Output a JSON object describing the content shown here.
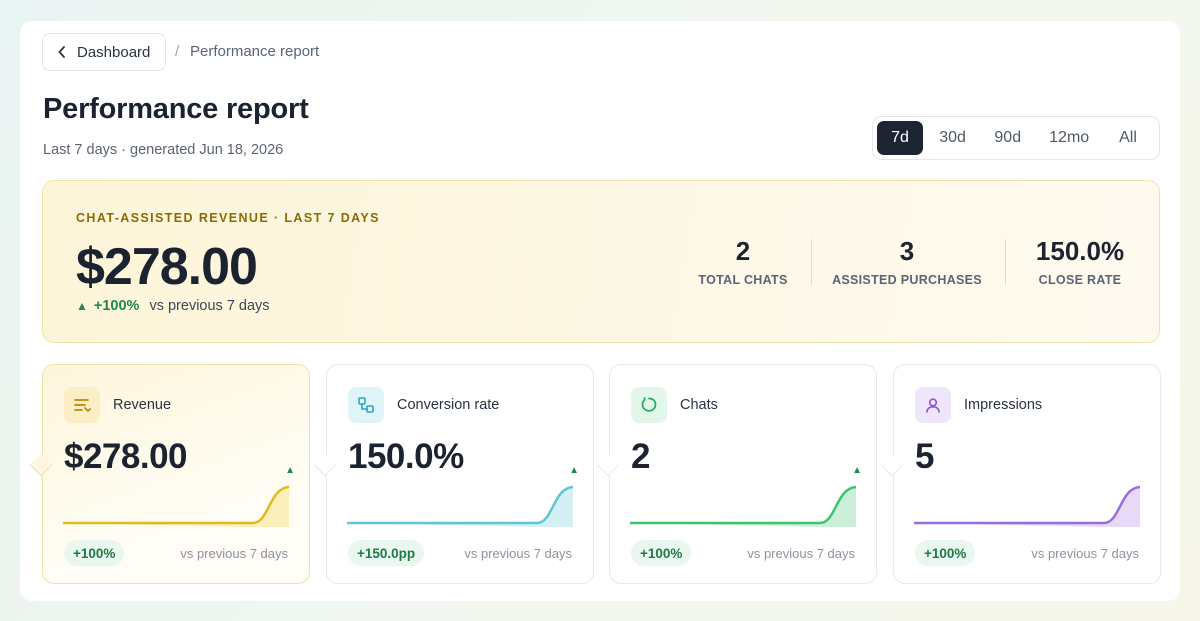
{
  "breadcrumb": {
    "back_label": "Dashboard",
    "separator": "/",
    "current": "Performance report"
  },
  "header": {
    "title": "Performance report",
    "subtitle": "Last 7 days · generated Jun 18, 2026"
  },
  "range": {
    "options": [
      "7d",
      "30d",
      "90d",
      "12mo",
      "All"
    ],
    "selected": "7d"
  },
  "hero": {
    "eyebrow": "CHAT-ASSISTED REVENUE · LAST 7 DAYS",
    "value": "$278.00",
    "delta_icon": "▲",
    "delta": "+100%",
    "delta_context": "vs previous 7 days",
    "stats": [
      {
        "value": "2",
        "label": "TOTAL CHATS"
      },
      {
        "value": "3",
        "label": "ASSISTED PURCHASES"
      },
      {
        "value": "150.0%",
        "label": "CLOSE RATE"
      }
    ]
  },
  "cards": [
    {
      "id": "revenue",
      "label": "Revenue",
      "value": "$278.00",
      "trend_icon": "▲",
      "delta": "+100%",
      "context": "vs previous 7 days",
      "icon": "receipt-lines-icon",
      "color": "#e2b91a",
      "icon_bg": "#fbeec4"
    },
    {
      "id": "conversion",
      "label": "Conversion rate",
      "value": "150.0%",
      "trend_icon": "▲",
      "delta": "+150.0pp",
      "context": "vs previous 7 days",
      "icon": "conversion-icon",
      "color": "#5ec6d6",
      "icon_bg": "#dff4f7"
    },
    {
      "id": "chats",
      "label": "Chats",
      "value": "2",
      "trend_icon": "▲",
      "delta": "+100%",
      "context": "vs previous 7 days",
      "icon": "chat-bubble-icon",
      "color": "#3cc46e",
      "icon_bg": "#e3f6ea"
    },
    {
      "id": "impressions",
      "label": "Impressions",
      "value": "5",
      "delta": "+100%",
      "context": "vs previous 7 days",
      "icon": "user-icon",
      "color": "#9b6be0",
      "icon_bg": "#efe6fb"
    }
  ],
  "colors": {
    "accent_dark": "#1d2534",
    "positive": "#1f8a4c",
    "hero_eyebrow": "#8a6a05"
  }
}
